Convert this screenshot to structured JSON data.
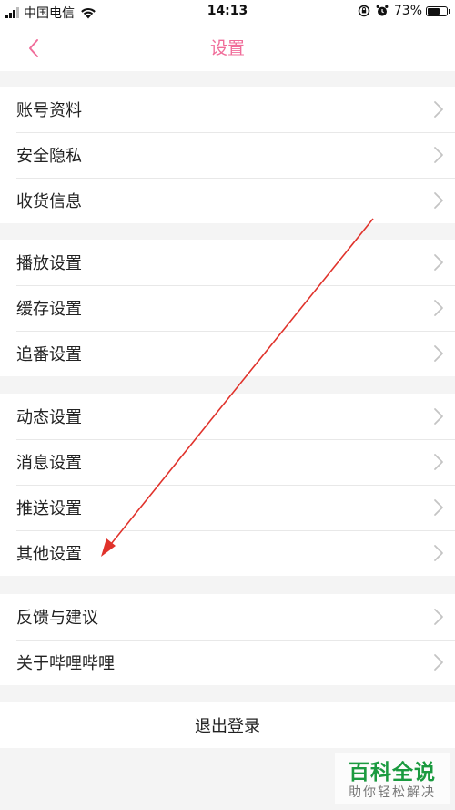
{
  "status_bar": {
    "carrier": "中国电信",
    "time": "14:13",
    "battery_percent": "73%",
    "battery_level": 0.73
  },
  "nav": {
    "back_icon": "chevron-left-icon",
    "title": "设置"
  },
  "groups": [
    {
      "items": [
        {
          "label": "账号资料"
        },
        {
          "label": "安全隐私"
        },
        {
          "label": "收货信息"
        }
      ]
    },
    {
      "items": [
        {
          "label": "播放设置"
        },
        {
          "label": "缓存设置"
        },
        {
          "label": "追番设置"
        }
      ]
    },
    {
      "items": [
        {
          "label": "动态设置"
        },
        {
          "label": "消息设置"
        },
        {
          "label": "推送设置"
        },
        {
          "label": "其他设置"
        }
      ]
    },
    {
      "items": [
        {
          "label": "反馈与建议"
        },
        {
          "label": "关于哔哩哔哩"
        }
      ]
    }
  ],
  "logout_label": "退出登录",
  "watermark": {
    "title": "百科全说",
    "subtitle": "助你轻松解决"
  },
  "colors": {
    "accent": "#f06d9a",
    "annotation_arrow": "#e0322b",
    "background": "#f4f4f4"
  }
}
